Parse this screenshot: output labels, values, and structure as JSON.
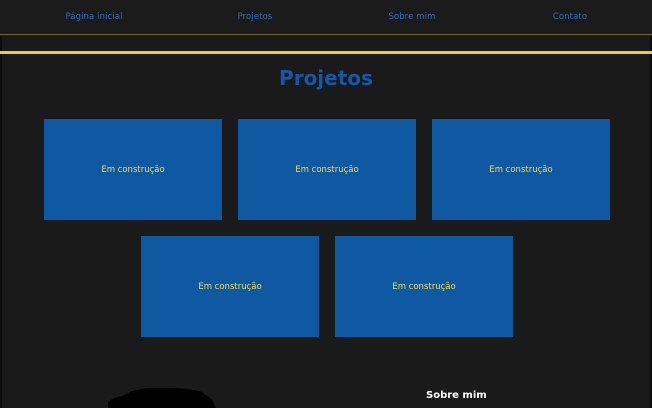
{
  "nav": {
    "items": [
      {
        "label": "Página inicial"
      },
      {
        "label": "Projetos"
      },
      {
        "label": "Sobre mim"
      },
      {
        "label": "Contato"
      }
    ]
  },
  "projects": {
    "title": "Projetos",
    "cards": [
      {
        "label": "Em construção"
      },
      {
        "label": "Em construção"
      },
      {
        "label": "Em construção"
      },
      {
        "label": "Em construção"
      },
      {
        "label": "Em construção"
      }
    ]
  },
  "about": {
    "heading": "Sobre mim"
  },
  "colors": {
    "background": "#1a1a1a",
    "accent_blue": "#1557a8",
    "card_blue": "#0f59a3",
    "accent_yellow": "#e7cf3a",
    "nav_text": "#2f6fbf"
  }
}
